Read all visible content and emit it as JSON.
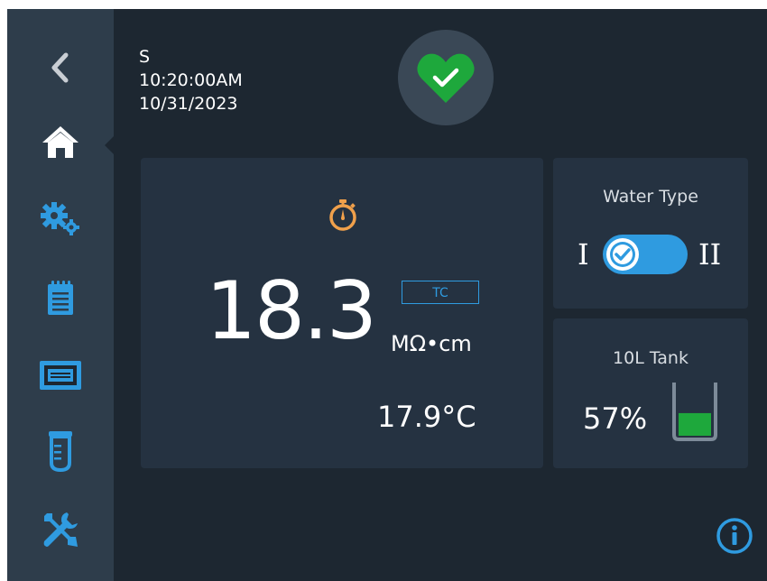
{
  "header": {
    "user": "S",
    "time": "10:20:00AM",
    "date": "10/31/2023"
  },
  "status": {
    "icon": "heart-check-icon",
    "color": "#1ea83c"
  },
  "sidebar": {
    "items": [
      {
        "name": "back",
        "icon": "chevron-left-icon"
      },
      {
        "name": "home",
        "icon": "home-icon",
        "active": true
      },
      {
        "name": "settings",
        "icon": "gears-icon"
      },
      {
        "name": "log",
        "icon": "notepad-icon"
      },
      {
        "name": "display",
        "icon": "screen-icon"
      },
      {
        "name": "dispense",
        "icon": "beaker-icon"
      },
      {
        "name": "service",
        "icon": "tools-icon"
      }
    ]
  },
  "main": {
    "timer_icon": "stopwatch-icon",
    "value": "18.3",
    "tc_label": "TC",
    "unit": "MΩ•cm",
    "temperature": "17.9°C"
  },
  "water_type": {
    "title": "Water Type",
    "left_label": "I",
    "right_label": "II",
    "selected": "I"
  },
  "tank": {
    "title": "10L Tank",
    "percent": "57%",
    "fill_fraction": 0.57,
    "icon": "tank-icon"
  },
  "info": {
    "icon": "info-icon"
  },
  "colors": {
    "accent_blue": "#2f9be0",
    "accent_orange": "#f0a04b",
    "green": "#1ea83c",
    "background": "#1d2731",
    "sidebar": "#2e3d4b",
    "panel": "#253241"
  }
}
